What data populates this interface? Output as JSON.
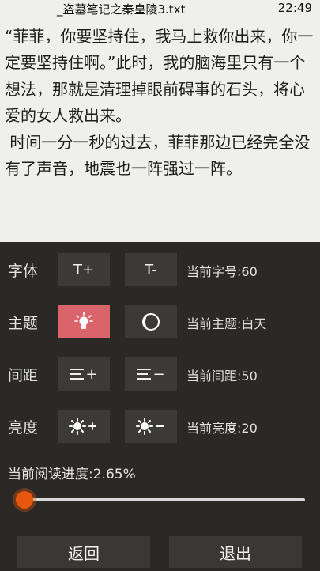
{
  "status": {
    "title": "_盗墓笔记之秦皇陵3.txt",
    "time": "22:49"
  },
  "reader": {
    "paragraphs": [
      "“菲菲，你要坚持住，我马上救你出来，你一定要坚持住啊。”此时，我的脑海里只有一个想法，那就是清理掉眼前碍事的石头，将心爱的女人救出来。",
      " 时间一分一秒的过去，菲菲那边已经完全没有了声音，地震也一阵强过一阵。"
    ]
  },
  "settings": {
    "font": {
      "label": "字体",
      "increase": "T+",
      "decrease": "T-",
      "info": "当前字号:60"
    },
    "theme": {
      "label": "主题",
      "info": "当前主题:白天"
    },
    "spacing": {
      "label": "间距",
      "info": "当前间距:50"
    },
    "brightness": {
      "label": "亮度",
      "info": "当前亮度:20"
    }
  },
  "progress": {
    "label": "当前阅读进度:2.65%",
    "value": 0.0265
  },
  "buttons": {
    "back": "返回",
    "exit": "退出"
  },
  "icons": {
    "theme_day": "lightbulb-icon",
    "theme_night": "moon-icon",
    "spacing_increase": "lines-plus-icon",
    "spacing_decrease": "lines-minus-icon",
    "brightness_increase": "sun-plus-icon",
    "brightness_decrease": "sun-minus-icon"
  },
  "colors": {
    "accent": "#e8570f",
    "theme_active": "#d9646a",
    "panel": "#2b2926"
  }
}
